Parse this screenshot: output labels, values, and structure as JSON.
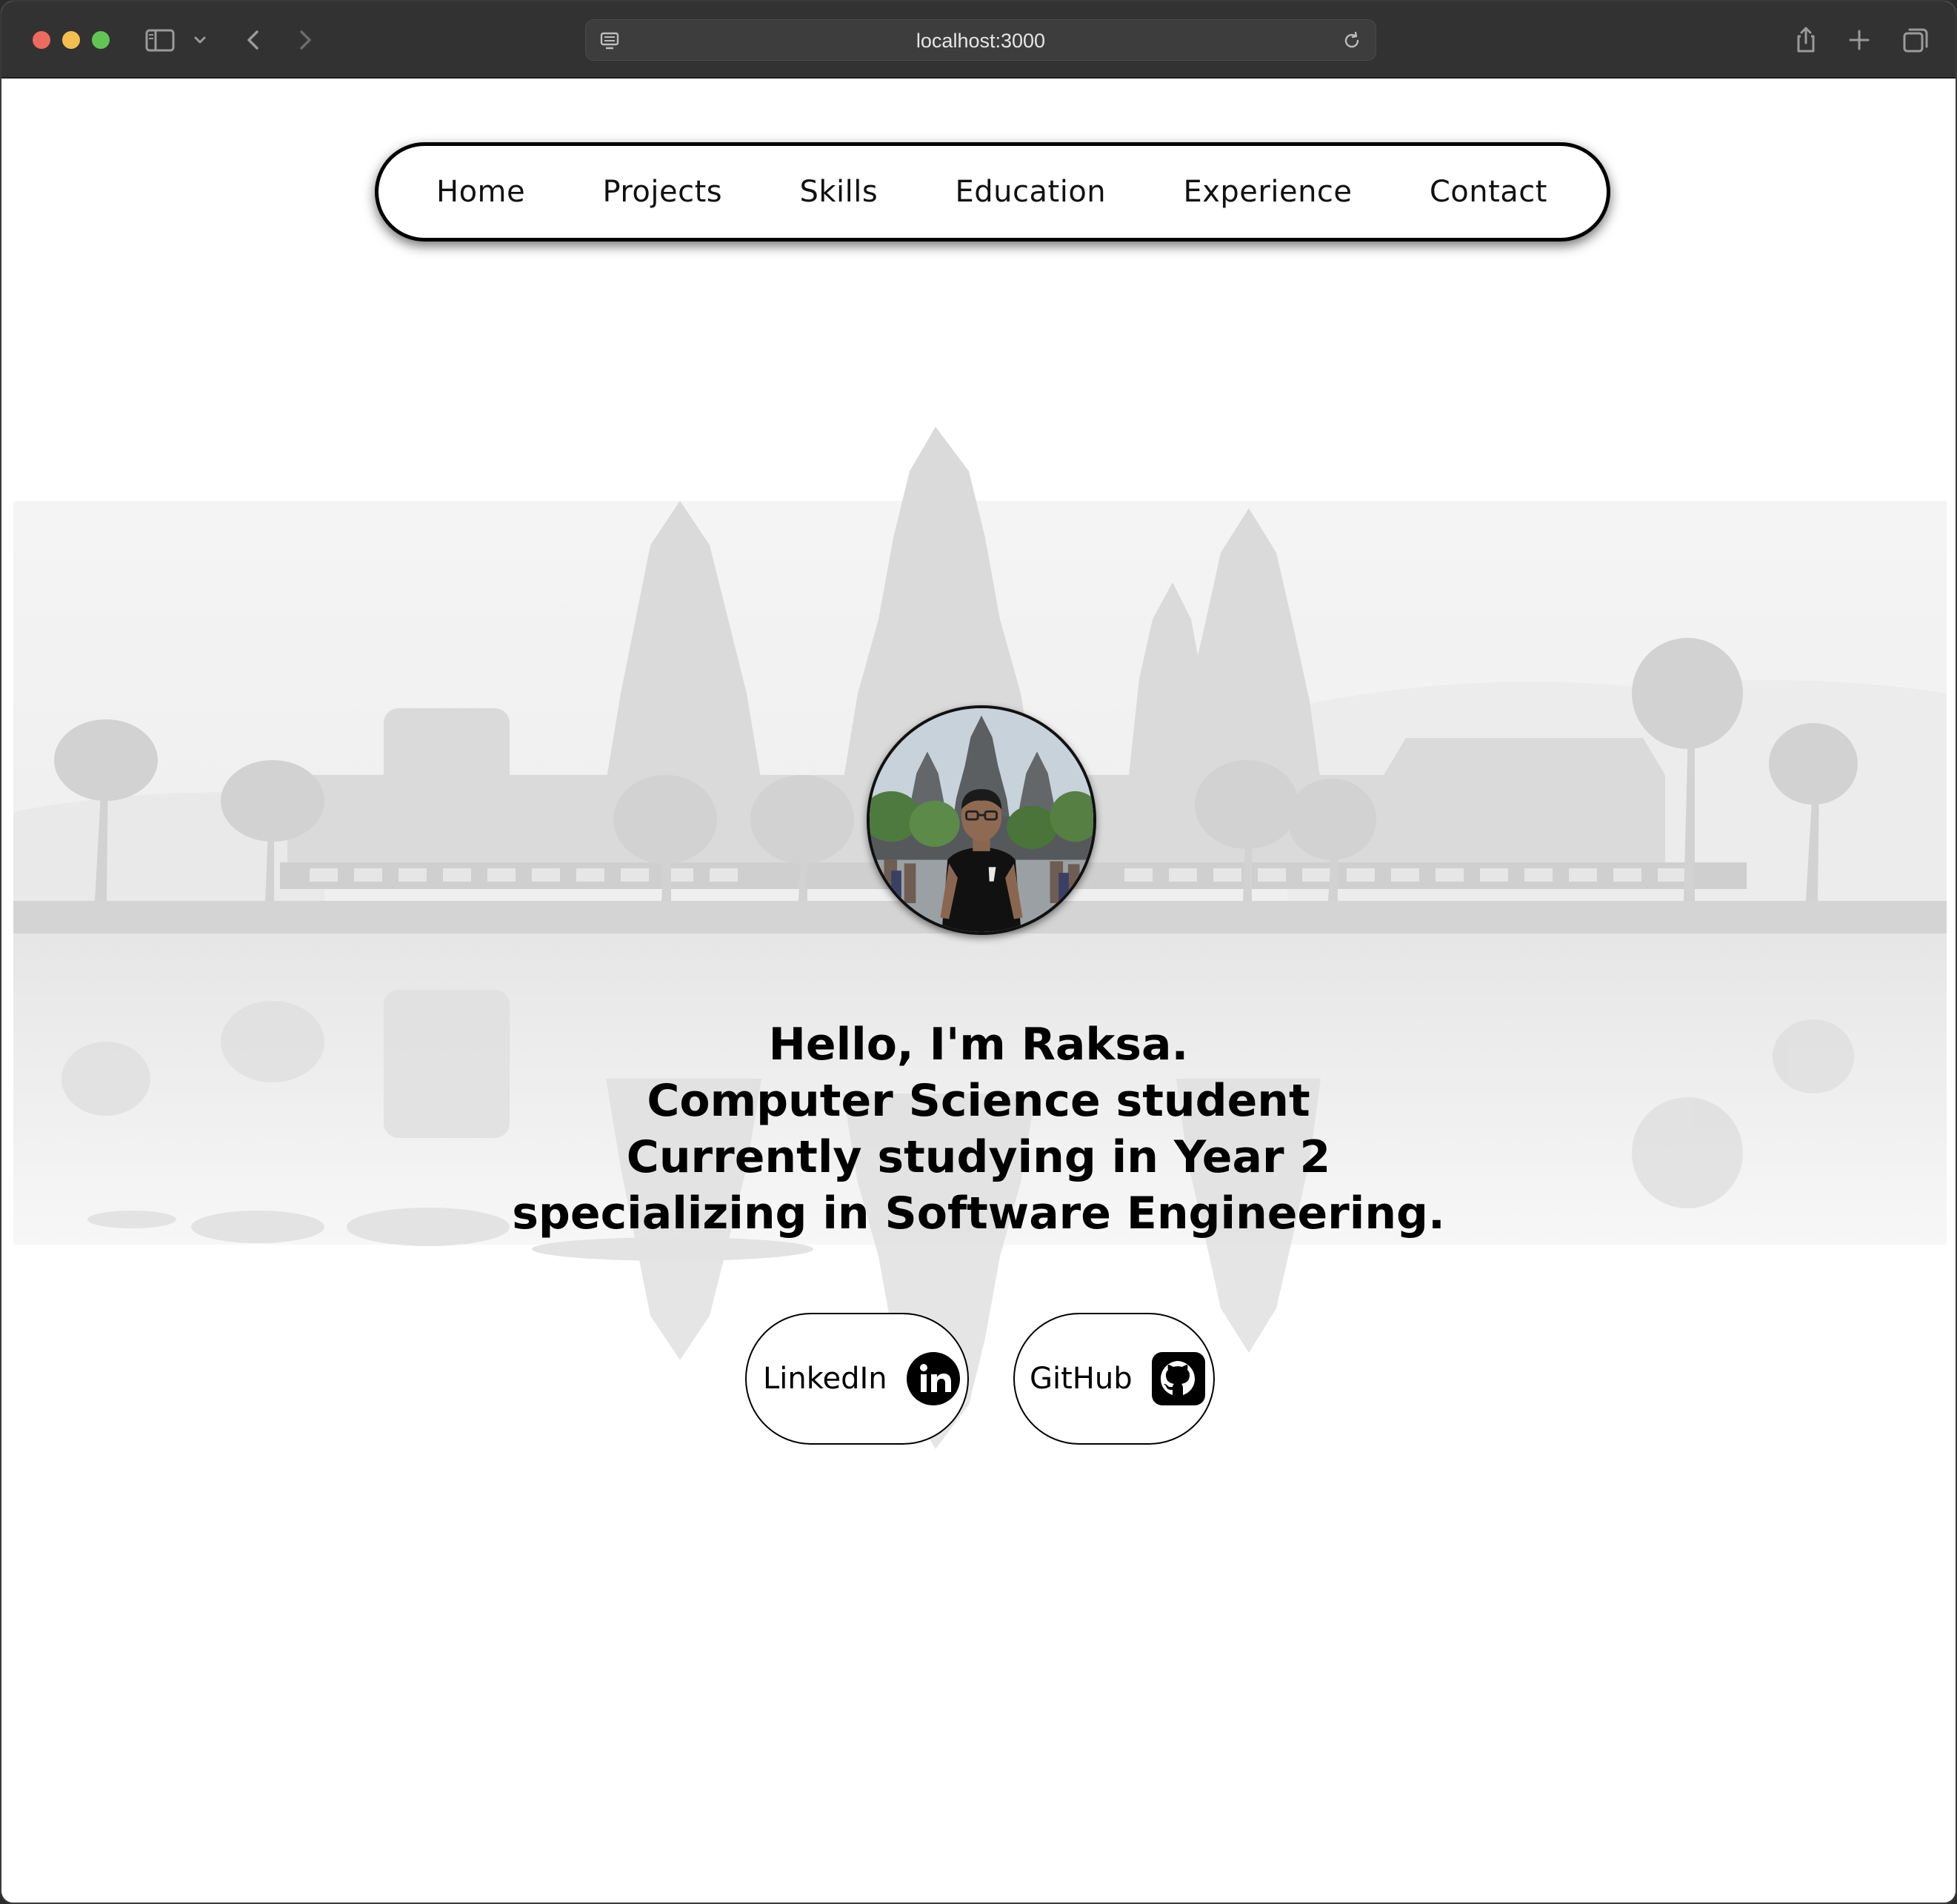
{
  "browser": {
    "url": "localhost:3000",
    "icons": [
      "sidebar-icon",
      "chevron-down-icon",
      "back-icon",
      "forward-icon",
      "page-icon",
      "reload-icon",
      "share-icon",
      "new-tab-icon",
      "tabs-overview-icon"
    ]
  },
  "nav": {
    "items": [
      "Home",
      "Projects",
      "Skills",
      "Education",
      "Experience",
      "Contact"
    ]
  },
  "hero": {
    "lines": [
      "Hello, I'm Raksa.",
      "Computer Science student",
      "Currently studying in Year 2",
      "specializing in Software Engineering."
    ],
    "avatar_icon": "profile-photo",
    "background_icon": "angkor-wat-silhouette"
  },
  "social": {
    "linkedin_label": "LinkedIn",
    "linkedin_icon": "linkedin-icon",
    "github_label": "GitHub",
    "github_icon": "github-icon"
  },
  "colors": {
    "chrome": "#323232",
    "text": "#000000",
    "background": "#ffffff",
    "scenery": "#d9d9d9"
  }
}
